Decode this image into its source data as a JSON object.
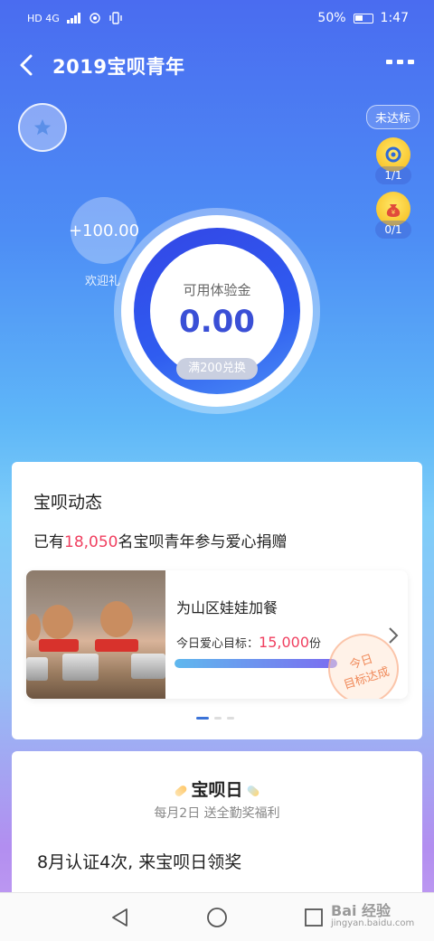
{
  "status_bar": {
    "left_text": "HD 4G",
    "battery": "50%",
    "time": "1:47"
  },
  "header": {
    "title": "2019宝呗青年",
    "icons": [
      "back-arrow-icon",
      "more-icon"
    ]
  },
  "badges": {
    "not_reached": "未达标",
    "task1_count": "1/1",
    "task2_count": "0/1"
  },
  "bonus_bubble": {
    "amount": "+100.00",
    "label": "欢迎礼"
  },
  "balance": {
    "label": "可用体验金",
    "value": "0.00",
    "redeem": "满200兑换"
  },
  "feed": {
    "title": "宝呗动态",
    "prefix": "已有",
    "count": "18,050",
    "suffix": "名宝呗青年参与爱心捐赠",
    "project": {
      "title": "为山区娃娃加餐",
      "goal_label": "今日爱心目标：",
      "goal_value": "15,000",
      "goal_unit": "份",
      "progress": 1.0,
      "stamp_line1": "今日",
      "stamp_line2": "目标达成"
    }
  },
  "day_card": {
    "title": "宝呗日",
    "subtitle": "每月2日 送全勤奖福利",
    "body": "8月认证4次, 来宝呗日领奖"
  },
  "watermark": {
    "text": "Bai 经验",
    "sub": "jingyan.baidu.com"
  },
  "colors": {
    "accent": "#3a4fd6",
    "highlight": "#f04060",
    "stamp": "#f08a5a"
  }
}
